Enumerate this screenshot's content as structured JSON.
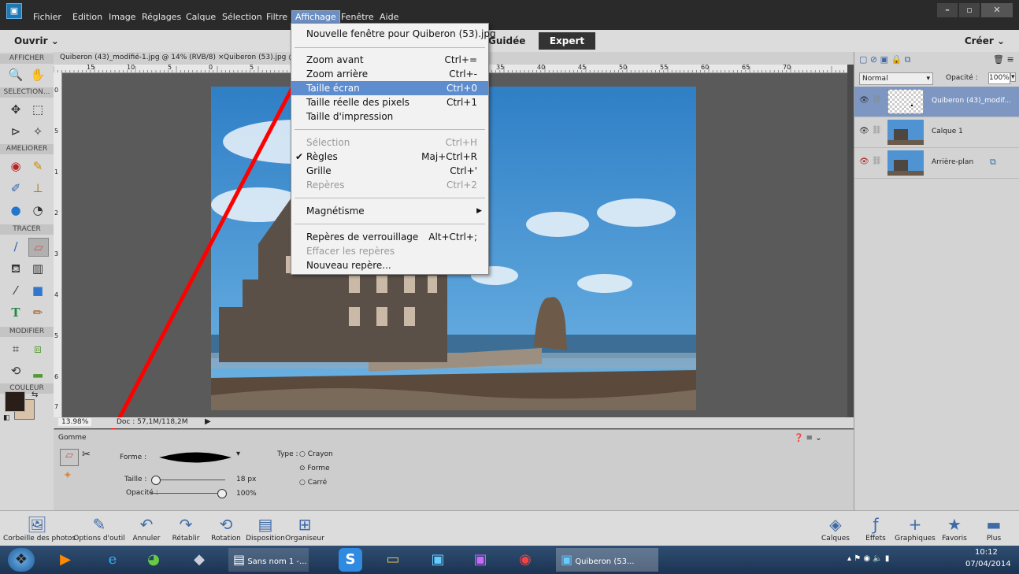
{
  "menubar": {
    "items": [
      "Fichier",
      "Edition",
      "Image",
      "Réglages",
      "Calque",
      "Sélection",
      "Filtre",
      "Affichage",
      "Fenêtre",
      "Aide"
    ],
    "active": "Affichage"
  },
  "topbar": {
    "open": "Ouvrir",
    "mode_guided": "Guidée",
    "mode_expert": "Expert",
    "create": "Créer"
  },
  "toolbox": {
    "sections": [
      "AFFICHER",
      "SELECTION...",
      "AMELIORER",
      "TRACER",
      "MODIFIER",
      "COULEUR"
    ]
  },
  "tabs": [
    {
      "label": "Quiberon (43)_modifié-1.jpg @ 14% (RVB/8)",
      "close": "×"
    },
    {
      "label": "Quiberon (53).jpg @"
    }
  ],
  "ruler_top_numbers": [
    "15",
    "10",
    "5",
    "0",
    "5",
    "35",
    "40",
    "45",
    "50",
    "55",
    "60",
    "65",
    "70"
  ],
  "ruler_left_numbers": [
    "0",
    "5",
    "1",
    "2",
    "3",
    "4",
    "5",
    "6",
    "7",
    "8",
    "9"
  ],
  "status": {
    "zoom": "13.98%",
    "doc": "Doc : 57,1M/118,2M"
  },
  "dropdown": {
    "items": [
      {
        "label": "Nouvelle fenêtre pour Quiberon (53).jpg",
        "shortcut": ""
      },
      {
        "label": "Zoom avant",
        "shortcut": "Ctrl+="
      },
      {
        "label": "Zoom arrière",
        "shortcut": "Ctrl+-"
      },
      {
        "label": "Taille écran",
        "shortcut": "Ctrl+0"
      },
      {
        "label": "Taille réelle des pixels",
        "shortcut": "Ctrl+1"
      },
      {
        "label": "Taille d'impression",
        "shortcut": ""
      },
      {
        "label": "Sélection",
        "shortcut": "Ctrl+H"
      },
      {
        "label": "Règles",
        "shortcut": "Maj+Ctrl+R"
      },
      {
        "label": "Grille",
        "shortcut": "Ctrl+'"
      },
      {
        "label": "Repères",
        "shortcut": "Ctrl+2"
      },
      {
        "label": "Magnétisme",
        "shortcut": ""
      },
      {
        "label": "Repères de verrouillage",
        "shortcut": "Alt+Ctrl+;"
      },
      {
        "label": "Effacer les repères",
        "shortcut": ""
      },
      {
        "label": "Nouveau repère...",
        "shortcut": ""
      }
    ],
    "highlighted": "Taille écran",
    "checked": "Règles"
  },
  "options": {
    "tool_name": "Gomme",
    "shape_label": "Forme :",
    "size_label": "Taille :",
    "size_value": "18 px",
    "size_fraction": 0.05,
    "opacity_label": "Opacité :",
    "opacity_value": "100%",
    "opacity_fraction": 1.0,
    "type_label": "Type :",
    "type_options": [
      "Crayon",
      "Forme",
      "Carré"
    ],
    "type_selected": "Forme"
  },
  "layers": {
    "blend_mode": "Normal",
    "opacity_label": "Opacité :",
    "opacity_value": "100%",
    "items": [
      {
        "name": "Quiberon (43)_modif...",
        "selected": true
      },
      {
        "name": "Calque 1",
        "selected": false
      },
      {
        "name": "Arrière-plan",
        "selected": false
      }
    ]
  },
  "panelbin": {
    "left": [
      "Corbeille des photos",
      "Options d'outil",
      "Annuler",
      "Rétablir",
      "Rotation",
      "Disposition",
      "Organiseur"
    ],
    "right": [
      "Calques",
      "Effets",
      "Graphiques",
      "Favoris",
      "Plus"
    ]
  },
  "taskbar": {
    "apps": [
      {
        "label": "Sans nom 1 -..."
      },
      {
        "label": "Quiberon (53..."
      }
    ],
    "time": "10:12",
    "date": "07/04/2014"
  },
  "colors": {
    "highlight": "#5d8ccf",
    "layer_selected": "#7e97c2",
    "annotation_line": "#ff0000"
  }
}
